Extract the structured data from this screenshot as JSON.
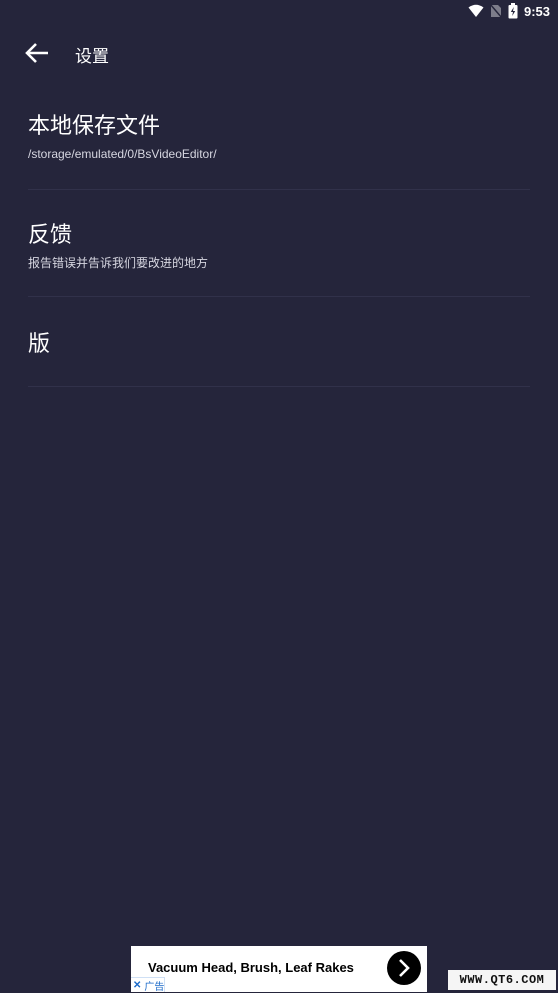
{
  "status_bar": {
    "time": "9:53",
    "icons": [
      "wifi-icon",
      "no-sim-icon",
      "battery-charging-icon"
    ]
  },
  "toolbar": {
    "back_icon": "arrow-left-icon",
    "title": "设置"
  },
  "settings": {
    "items": [
      {
        "title": "本地保存文件",
        "subtitle": "/storage/emulated/0/BsVideoEditor/"
      },
      {
        "title": "反馈",
        "subtitle": "报告错误并告诉我们要改进的地方"
      },
      {
        "title": "版",
        "subtitle": ""
      }
    ]
  },
  "ad": {
    "text": "Vacuum Head, Brush, Leaf Rakes",
    "badge_close": "✕",
    "badge_label": "广告",
    "arrow_icon": "chevron-right-icon"
  },
  "watermark": {
    "text": "WWW.QT6.COM"
  },
  "colors": {
    "background": "#25253b",
    "divider": "#31314a",
    "text": "#ffffff"
  }
}
